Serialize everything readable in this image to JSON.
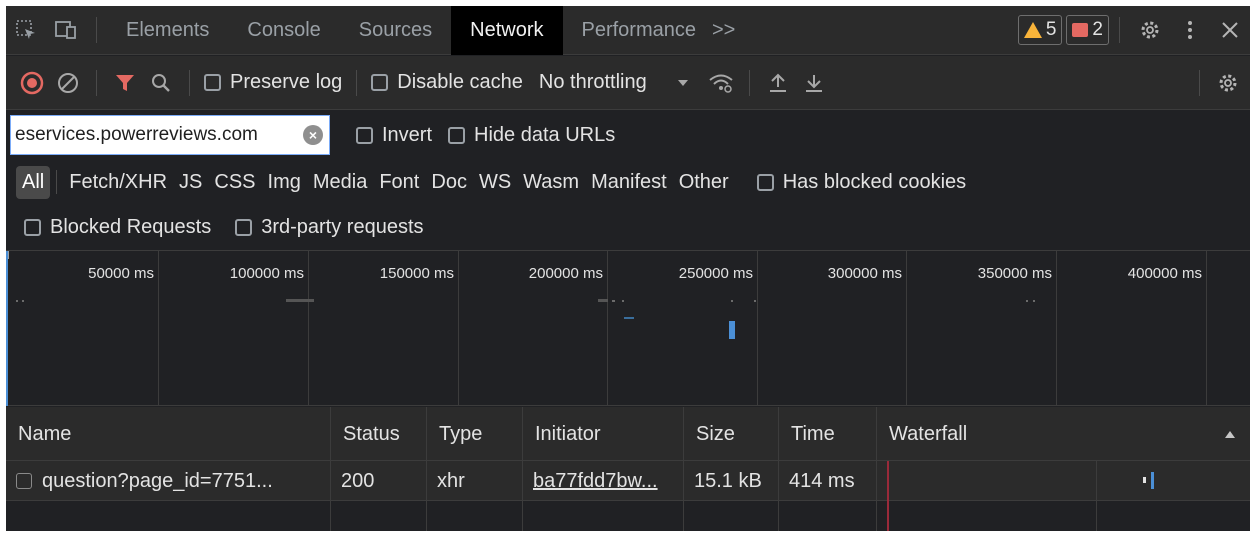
{
  "tabs": {
    "elements": "Elements",
    "console": "Console",
    "sources": "Sources",
    "network": "Network",
    "performance": "Performance",
    "more": ">>"
  },
  "badges": {
    "warnings": "5",
    "errors": "2"
  },
  "toolbar": {
    "preserve_log": "Preserve log",
    "disable_cache": "Disable cache",
    "throttling": "No throttling"
  },
  "filter": {
    "value": "eservices.powerreviews.com",
    "invert": "Invert",
    "hide_data_urls": "Hide data URLs"
  },
  "types": [
    "All",
    "Fetch/XHR",
    "JS",
    "CSS",
    "Img",
    "Media",
    "Font",
    "Doc",
    "WS",
    "Wasm",
    "Manifest",
    "Other"
  ],
  "has_blocked_cookies": "Has blocked cookies",
  "blocked_requests": "Blocked Requests",
  "third_party": "3rd-party requests",
  "overview_ticks": [
    "50000 ms",
    "100000 ms",
    "150000 ms",
    "200000 ms",
    "250000 ms",
    "300000 ms",
    "350000 ms",
    "400000 ms"
  ],
  "columns": [
    "Name",
    "Status",
    "Type",
    "Initiator",
    "Size",
    "Time",
    "Waterfall"
  ],
  "rows": [
    {
      "name": "question?page_id=7751...",
      "status": "200",
      "type": "xhr",
      "initiator": "ba77fdd7bw...",
      "size": "15.1 kB",
      "time": "414 ms"
    }
  ],
  "colors": {
    "accent_active": "#000000",
    "error_record": "#e46962",
    "warning": "#f9b43a",
    "filter_focus": "#7cacf8"
  }
}
